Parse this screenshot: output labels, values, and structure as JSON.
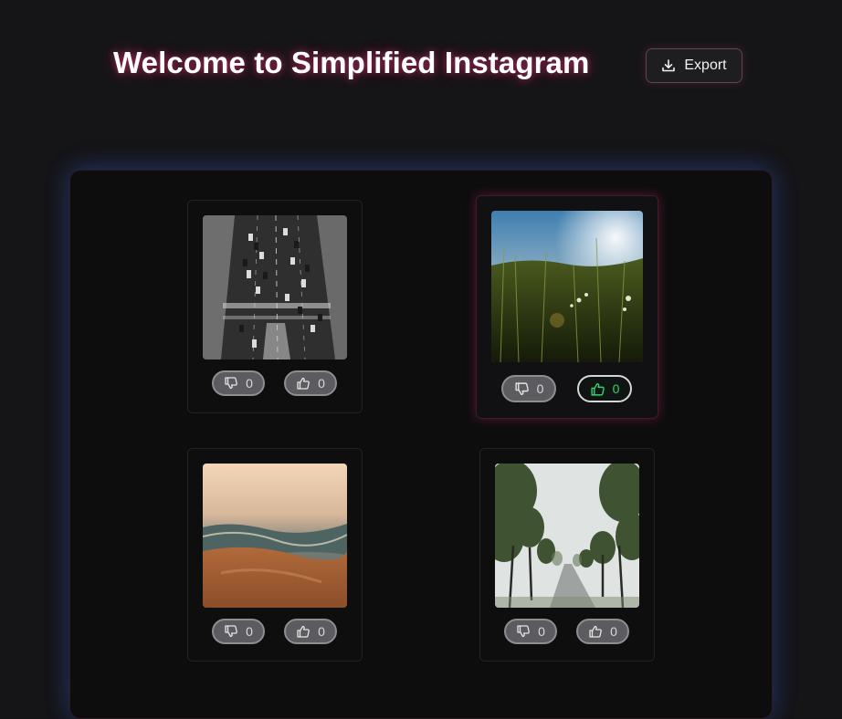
{
  "header": {
    "title": "Welcome to Simplified Instagram",
    "export_label": "Export"
  },
  "posts": [
    {
      "photo": "aerial city street traffic black-and-white",
      "dislikes": "0",
      "likes": "0",
      "liked": false
    },
    {
      "photo": "grass field at sunset",
      "dislikes": "0",
      "likes": "0",
      "liked": true
    },
    {
      "photo": "sea wave on sandy shore",
      "dislikes": "0",
      "likes": "0",
      "liked": false
    },
    {
      "photo": "foggy road lined with trees",
      "dislikes": "0",
      "likes": "0",
      "liked": false
    }
  ],
  "icons": {
    "export": "download-icon",
    "dislike": "thumbs-down-icon",
    "like": "thumbs-up-icon"
  },
  "colors": {
    "background": "#151517",
    "panel": "#0d0d0e",
    "title_glow": "#e0286e",
    "panel_glow": "#3c5ac8",
    "vote_button": "#5c5c60",
    "liked_accent": "#35d46e"
  }
}
